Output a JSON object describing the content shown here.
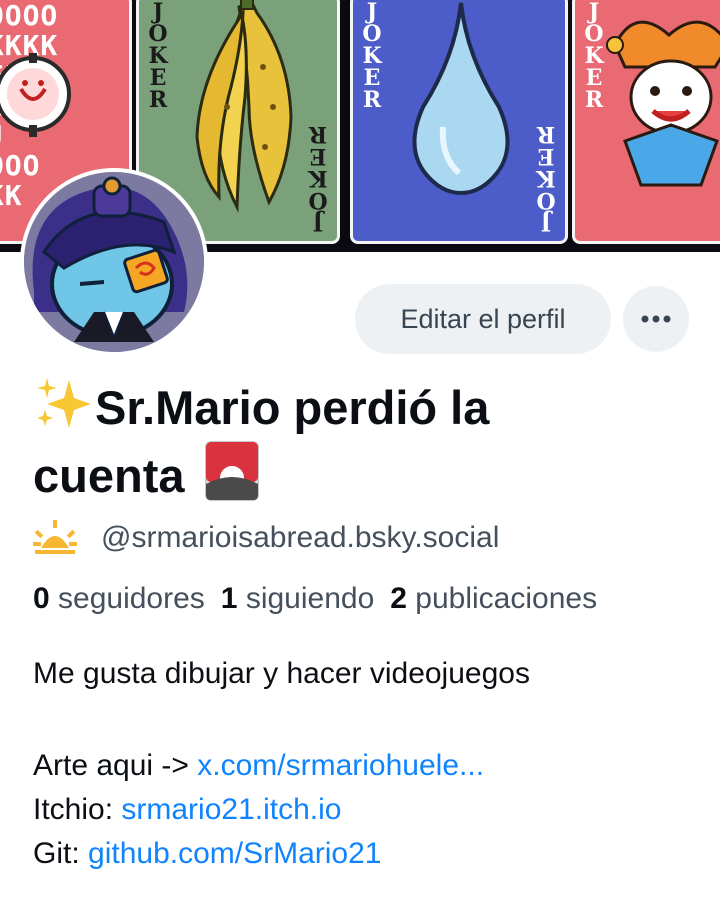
{
  "banner": {
    "card_letters": "OOOOO\nKKKKK\nEEE\nRR\nJJ\nOOOO\nKKK",
    "card_label": "JOKER",
    "icons": [
      "banana-icon",
      "water-drop-icon",
      "jester-icon"
    ]
  },
  "profile": {
    "display_name_line1": "Sr.Mario perdió la",
    "display_name_line2": "cuenta",
    "handle": "@srmarioisabread.bsky.social",
    "edit_button_label": "Editar el perfil",
    "more_button_label": "···"
  },
  "stats": {
    "followers_count": "0",
    "followers_label": "seguidores",
    "following_count": "1",
    "following_label": "siguiendo",
    "posts_count": "2",
    "posts_label": "publicaciones"
  },
  "bio": {
    "line1": "Me gusta dibujar y hacer videojuegos",
    "art_prefix": "Arte aqui -> ",
    "art_link": "x.com/srmariohuele...",
    "itch_prefix": "Itchio: ",
    "itch_link": "srmario21.itch.io",
    "git_prefix": "Git: ",
    "git_link": "github.com/SrMario21"
  },
  "colors": {
    "link": "#1083fe",
    "text": "#0b0f14",
    "muted": "#45505c",
    "button_bg": "#eef1f4"
  }
}
